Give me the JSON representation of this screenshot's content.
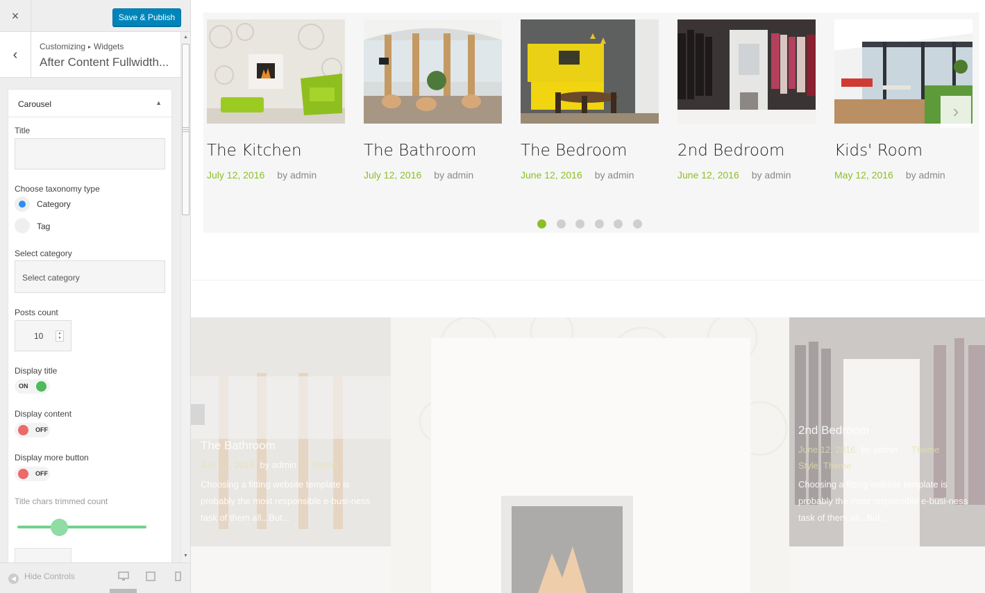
{
  "topbar": {
    "close_icon": "×",
    "publish_label": "Save & Publish",
    "publish_color": "#0085ba"
  },
  "header": {
    "back_icon": "‹",
    "crumb_parent": "Customizing",
    "crumb_sep": "▸",
    "crumb_child": "Widgets",
    "panel_title": "After Content Fullwidth..."
  },
  "widget": {
    "title": "Carousel",
    "toggle_icon": "▲",
    "title_label": "Title",
    "title_value": "",
    "taxonomy_label": "Choose taxonomy type",
    "taxonomy_options": [
      {
        "label": "Category",
        "selected": true
      },
      {
        "label": "Tag",
        "selected": false
      }
    ],
    "category_label": "Select category",
    "category_value": "Select category",
    "posts_count_label": "Posts count",
    "posts_count_value": "10",
    "display_title_label": "Display title",
    "display_title_state": "ON",
    "display_content_label": "Display content",
    "display_content_state": "OFF",
    "display_more_label": "Display more button",
    "display_more_state": "OFF",
    "trim_label": "Title chars trimmed count"
  },
  "footer": {
    "hide_label": "Hide Controls",
    "hide_icon": "◀"
  },
  "carousel": {
    "accent": "#8cbf26",
    "cards": [
      {
        "title": "The Kitchen",
        "date": "July 12, 2016",
        "author": "by admin"
      },
      {
        "title": "The Bathroom",
        "date": "July 12, 2016",
        "author": "by admin"
      },
      {
        "title": "The Bedroom",
        "date": "June 12, 2016",
        "author": "by admin"
      },
      {
        "title": "2nd Bedroom",
        "date": "June 12, 2016",
        "author": "by admin"
      },
      {
        "title": "Kids' Room",
        "date": "May 12, 2016",
        "author": "by admin"
      }
    ],
    "next_icon": "›",
    "pages": 6,
    "active_page": 1
  },
  "tiles": [
    {
      "title": "The Bathroom",
      "date": "July 12, 2016",
      "author": "by admin",
      "tag": "Theme",
      "excerpt": "Choosing a fitting website template is probably the most responsible e-busi-ness task of them all...But..."
    },
    {
      "title": "2nd Bedroom",
      "date": "June 12, 2016",
      "author": "by admin",
      "tag": "Theme",
      "tag2": "Style, Theme",
      "excerpt": "Choosing a fitting website template is probably the most responsible e-busi-ness task of them all...But..."
    }
  ]
}
